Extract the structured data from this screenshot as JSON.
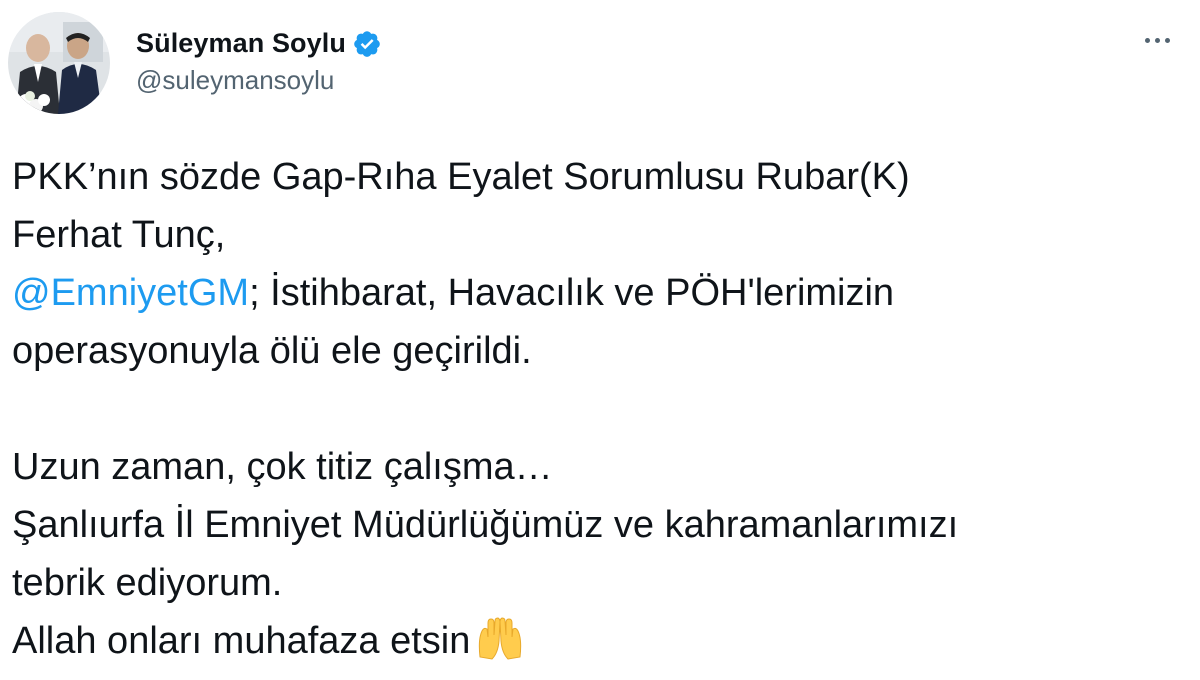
{
  "author": {
    "display_name": "Süleyman Soylu",
    "handle": "@suleymansoylu",
    "verified_icon": "verified-badge-icon"
  },
  "more_icon": "more-horizontal-icon",
  "tweet": {
    "line1": "PKK’nın sözde Gap-Rıha Eyalet Sorumlusu Rubar(K)",
    "line2": "Ferhat Tunç,",
    "mention": "@EmniyetGM",
    "line3_rest": "; İstihbarat, Havacılık ve PÖH'lerimizin",
    "line4": "operasyonuyla ölü ele geçirildi.",
    "line5": "Uzun zaman, çok titiz çalışma…",
    "line6": "Şanlıurfa İl Emniyet Müdürlüğümüz ve kahramanlarımızı",
    "line7": "tebrik ediyorum.",
    "line8": "Allah onları muhafaza etsin",
    "emoji": "raising-hands-emoji"
  },
  "colors": {
    "text": "#0f1419",
    "secondary": "#536471",
    "link": "#1d9bf0",
    "verified": "#1d9bf0"
  }
}
